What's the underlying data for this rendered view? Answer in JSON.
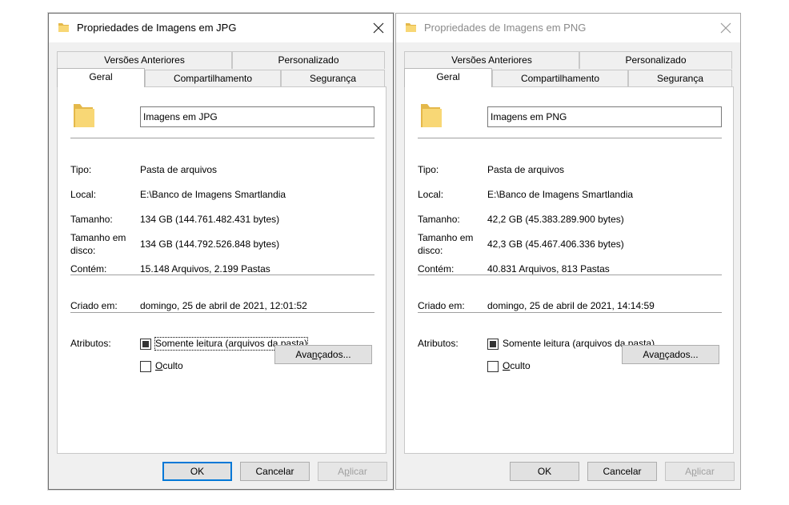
{
  "dialogs": {
    "jpg": {
      "title": "Propriedades de Imagens em JPG",
      "tabs": {
        "versoes": "Versões Anteriores",
        "personalizado": "Personalizado",
        "geral": "Geral",
        "compartilhamento": "Compartilhamento",
        "seguranca": "Segurança"
      },
      "folder_name": "Imagens em JPG",
      "labels": {
        "tipo": "Tipo:",
        "local": "Local:",
        "tamanho": "Tamanho:",
        "tamanho_disco_1": "Tamanho em",
        "tamanho_disco_2": "disco:",
        "contem": "Contém:",
        "criado": "Criado em:",
        "atributos": "Atributos:"
      },
      "values": {
        "tipo": "Pasta de arquivos",
        "local": "E:\\Banco de Imagens Smartlandia",
        "tamanho": "134 GB (144.761.482.431 bytes)",
        "tamanho_disco": "134 GB (144.792.526.848 bytes)",
        "contem": "15.148 Arquivos, 2.199 Pastas",
        "criado": "domingo, 25 de abril de 2021, 12:01:52"
      },
      "attributes": {
        "readonly_label": "Somente leitura (arquivos da pasta)",
        "readonly_state": "indeterminate",
        "hidden_first": "O",
        "hidden_rest": "culto",
        "hidden_checked": false
      },
      "buttons": {
        "adv_pre": "Ava",
        "adv_u": "n",
        "adv_post": "çados...",
        "ok": "OK",
        "cancel": "Cancelar",
        "apply_pre": "A",
        "apply_u": "p",
        "apply_post": "licar"
      }
    },
    "png": {
      "title": "Propriedades de Imagens em PNG",
      "tabs": {
        "versoes": "Versões Anteriores",
        "personalizado": "Personalizado",
        "geral": "Geral",
        "compartilhamento": "Compartilhamento",
        "seguranca": "Segurança"
      },
      "folder_name": "Imagens em PNG",
      "labels": {
        "tipo": "Tipo:",
        "local": "Local:",
        "tamanho": "Tamanho:",
        "tamanho_disco_1": "Tamanho em",
        "tamanho_disco_2": "disco:",
        "contem": "Contém:",
        "criado": "Criado em:",
        "atributos": "Atributos:"
      },
      "values": {
        "tipo": "Pasta de arquivos",
        "local": "E:\\Banco de Imagens Smartlandia",
        "tamanho": "42,2 GB (45.383.289.900 bytes)",
        "tamanho_disco": "42,3 GB (45.467.406.336 bytes)",
        "contem": "40.831 Arquivos, 813 Pastas",
        "criado": "domingo, 25 de abril de 2021, 14:14:59"
      },
      "attributes": {
        "readonly_label": "Somente leitura (arquivos da pasta)",
        "readonly_state": "indeterminate",
        "hidden_first": "O",
        "hidden_rest": "culto",
        "hidden_checked": false
      },
      "buttons": {
        "adv_pre": "Ava",
        "adv_u": "n",
        "adv_post": "çados...",
        "ok": "OK",
        "cancel": "Cancelar",
        "apply_pre": "A",
        "apply_u": "p",
        "apply_post": "licar"
      }
    }
  },
  "icons": {
    "folder": "folder-icon",
    "close": "close-icon"
  },
  "colors": {
    "folder": "#f8d775",
    "folder_dark": "#e4b84a",
    "focus_blue": "#0078d7",
    "dialog_bg": "#f0f0f0"
  }
}
